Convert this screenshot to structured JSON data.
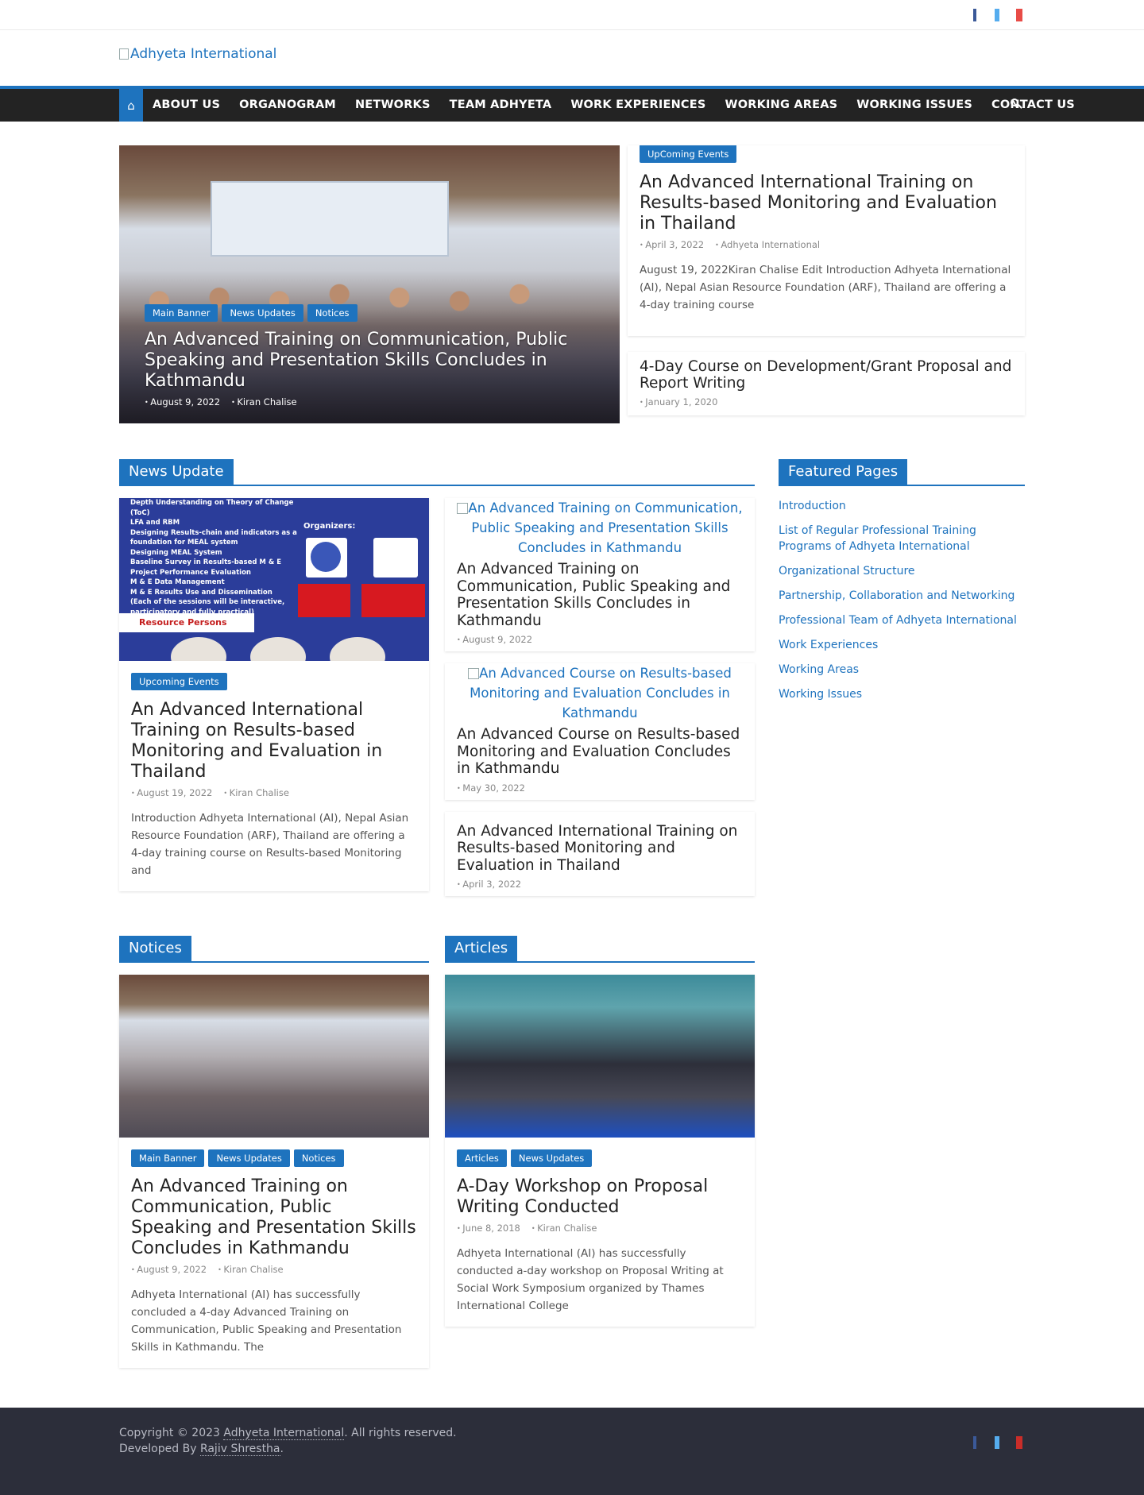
{
  "site": {
    "logo_alt": "Adhyeta International",
    "social": [
      "facebook-icon",
      "twitter-icon",
      "youtube-icon"
    ]
  },
  "nav": {
    "home_icon": "home-icon",
    "items": [
      "ABOUT US",
      "ORGANOGRAM",
      "NETWORKS",
      "TEAM ADHYETA",
      "WORK EXPERIENCES",
      "WORKING AREAS",
      "WORKING ISSUES",
      "CONTACT US"
    ]
  },
  "slider": {
    "cats": [
      "Main Banner",
      "News Updates",
      "Notices"
    ],
    "title": "An Advanced Training on Communication, Public Speaking and Presentation Skills Concludes in Kathmandu",
    "date": "August 9, 2022",
    "author": "Kiran Chalise"
  },
  "featured_top": {
    "cat": "UpComing Events",
    "title": "An Advanced International Training on Results-based Monitoring and Evaluation in Thailand",
    "date": "April 3, 2022",
    "author": "Adhyeta International",
    "excerpt": " August 19, 2022Kiran Chalise Edit Introduction Adhyeta International (AI), Nepal Asian Resource Foundation (ARF), Thailand are offering a 4-day training course"
  },
  "featured_bottom": {
    "title": "4-Day Course on Development/Grant Proposal and Report Writing",
    "date": "January 1, 2020"
  },
  "news_update": {
    "heading": "News Update",
    "main": {
      "poster_lines": [
        "Depth Understanding on Theory of Change",
        "(ToC)",
        "LFA and RBM",
        "Designing Results-chain and indicators as a",
        "foundation for MEAL system",
        "Designing MEAL System",
        "Baseline Survey in Results-based M & E",
        "Project Performance Evaluation",
        "M & E Data Management",
        "M & E Results Use and Dissemination",
        "(Each of the sessions will be interactive,",
        "participatory and fully practical)"
      ],
      "poster_org": "Organizers:",
      "poster_res": "Resource Persons",
      "cat": "Upcoming Events",
      "title": "An Advanced International Training on Results-based Monitoring and Evaluation in Thailand",
      "date": "August 19, 2022",
      "author": "Kiran Chalise",
      "excerpt": "Introduction Adhyeta International (AI), Nepal Asian Resource Foundation (ARF), Thailand are offering a 4-day training course on Results-based Monitoring and"
    },
    "items": [
      {
        "img_alt": "An Advanced Training on Communication, Public Speaking and Presentation Skills Concludes in Kathmandu",
        "title": "An Advanced Training on Communication, Public Speaking and Presentation Skills Concludes in Kathmandu",
        "date": "August 9, 2022"
      },
      {
        "img_alt": "An Advanced Course on Results-based Monitoring and Evaluation Concludes in Kathmandu",
        "title": "An Advanced Course on Results-based Monitoring and Evaluation Concludes in Kathmandu",
        "date": "May 30, 2022"
      },
      {
        "title": "An Advanced International Training on Results-based Monitoring and Evaluation in Thailand",
        "date": "April 3, 2022"
      }
    ]
  },
  "featured_pages": {
    "heading": "Featured Pages",
    "links": [
      "Introduction",
      "List of Regular Professional Training Programs of Adhyeta International",
      "Organizational Structure",
      "Partnership, Collaboration and Networking",
      "Professional Team of Adhyeta International",
      "Work Experiences",
      "Working Areas",
      "Working Issues"
    ]
  },
  "notices": {
    "heading": "Notices",
    "cats": [
      "Main Banner",
      "News Updates",
      "Notices"
    ],
    "title": "An Advanced Training on Communication, Public Speaking and Presentation Skills Concludes in Kathmandu",
    "date": "August 9, 2022",
    "author": "Kiran Chalise",
    "excerpt": "Adhyeta International (AI) has successfully concluded a 4-day Advanced Training on Communication, Public Speaking and Presentation Skills in Kathmandu. The"
  },
  "articles": {
    "heading": "Articles",
    "cats": [
      "Articles",
      "News Updates"
    ],
    "title": "A-Day Workshop on Proposal Writing Conducted",
    "date": "June 8, 2018",
    "author": "Kiran Chalise",
    "excerpt": "Adhyeta International (AI) has successfully conducted a-day workshop on Proposal Writing at Social Work Symposium organized by Thames International College"
  },
  "footer": {
    "copy_prefix": "Copyright © 2023 ",
    "copy_link": "Adhyeta International",
    "copy_suffix": ". All rights reserved.",
    "dev_prefix": "Developed By ",
    "dev_link": "Rajiv Shrestha",
    "dev_suffix": "."
  },
  "colors": {
    "accent": "#1e73be",
    "nav_bg": "#232323",
    "footer_bg": "#2c2e3a"
  }
}
